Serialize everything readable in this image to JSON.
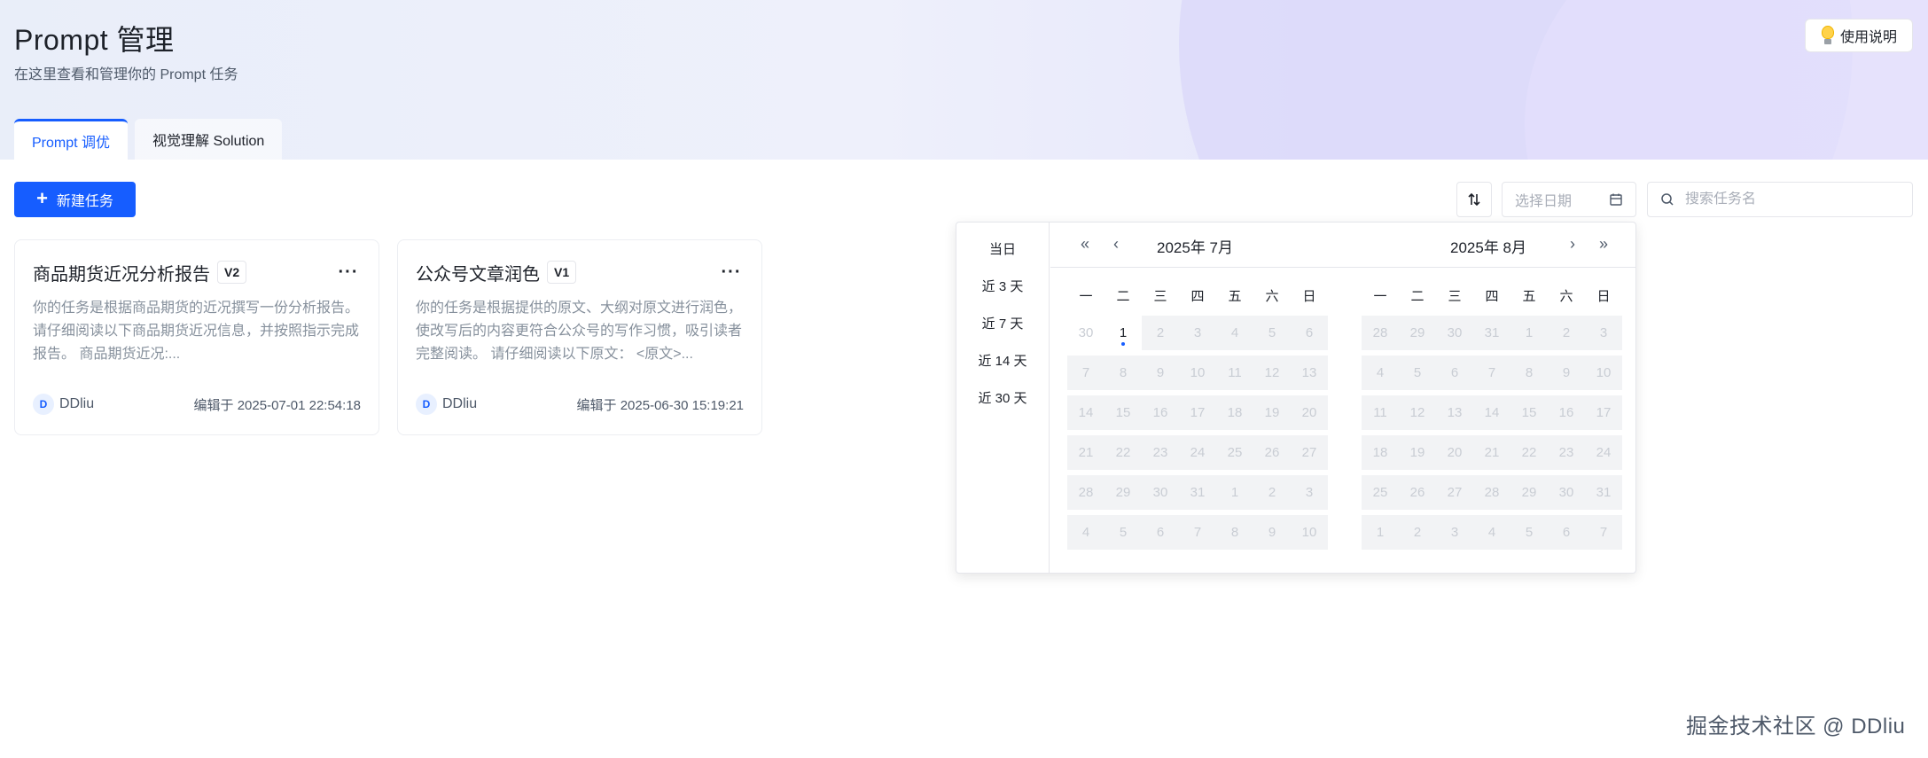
{
  "header": {
    "title": "Prompt 管理",
    "subtitle": "在这里查看和管理你的 Prompt 任务",
    "help_label": "使用说明"
  },
  "tabs": [
    {
      "label": "Prompt 调优",
      "active": true
    },
    {
      "label": "视觉理解 Solution",
      "active": false
    }
  ],
  "toolbar": {
    "new_task_label": "新建任务",
    "date_placeholder": "选择日期",
    "search_placeholder": "搜索任务名"
  },
  "cards": [
    {
      "title": "商品期货近况分析报告",
      "version": "V2",
      "description": "你的任务是根据商品期货的近况撰写一份分析报告。请仔细阅读以下商品期货近况信息，并按照指示完成报告。 商品期货近况:...",
      "author_initial": "D",
      "author": "DDliu",
      "edited": "编辑于 2025-07-01 22:54:18"
    },
    {
      "title": "公众号文章润色",
      "version": "V1",
      "description": "你的任务是根据提供的原文、大纲对原文进行润色，使改写后的内容更符合公众号的写作习惯，吸引读者完整阅读。 请仔细阅读以下原文： <原文>...",
      "author_initial": "D",
      "author": "DDliu",
      "edited": "编辑于 2025-06-30 15:19:21"
    }
  ],
  "picker": {
    "shortcuts": [
      "当日",
      "近 3 天",
      "近 7 天",
      "近 14 天",
      "近 30 天"
    ],
    "weekdays": [
      "一",
      "二",
      "三",
      "四",
      "五",
      "六",
      "日"
    ],
    "left": {
      "title": "2025年 7月",
      "days": [
        "30",
        "1",
        "2",
        "3",
        "4",
        "5",
        "6",
        "7",
        "8",
        "9",
        "10",
        "11",
        "12",
        "13",
        "14",
        "15",
        "16",
        "17",
        "18",
        "19",
        "20",
        "21",
        "22",
        "23",
        "24",
        "25",
        "26",
        "27",
        "28",
        "29",
        "30",
        "31",
        "1",
        "2",
        "3",
        "4",
        "5",
        "6",
        "7",
        "8",
        "9",
        "10"
      ],
      "today_index": 1
    },
    "right": {
      "title": "2025年 8月",
      "days": [
        "28",
        "29",
        "30",
        "31",
        "1",
        "2",
        "3",
        "4",
        "5",
        "6",
        "7",
        "8",
        "9",
        "10",
        "11",
        "12",
        "13",
        "14",
        "15",
        "16",
        "17",
        "18",
        "19",
        "20",
        "21",
        "22",
        "23",
        "24",
        "25",
        "26",
        "27",
        "28",
        "29",
        "30",
        "31",
        "1",
        "2",
        "3",
        "4",
        "5",
        "6",
        "7"
      ]
    }
  },
  "watermark": "掘金技术社区 @ DDliu",
  "colors": {
    "primary": "#165dff",
    "disabled_text": "#c9cdd4",
    "disabled_bg": "#f2f3f5"
  }
}
